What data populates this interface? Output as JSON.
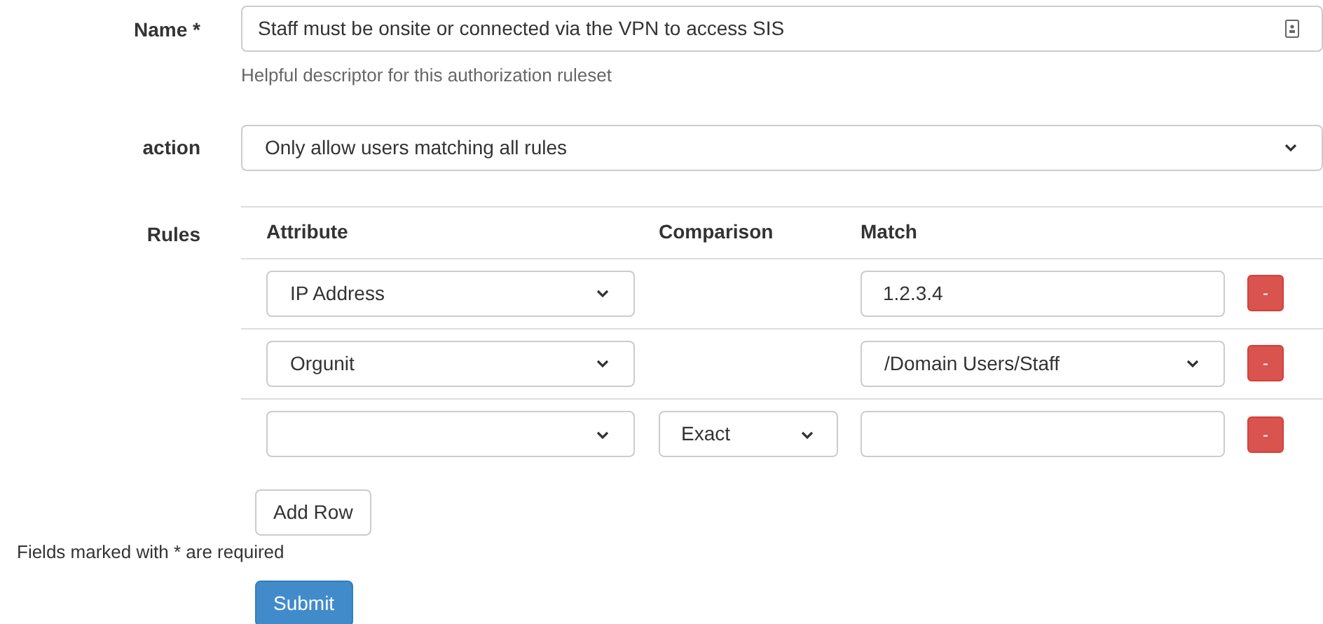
{
  "name_field": {
    "label": "Name *",
    "value": "Staff must be onsite or connected via the VPN to access SIS",
    "help": "Helpful descriptor for this authorization ruleset"
  },
  "action_field": {
    "label": "action",
    "value": "Only allow users matching all rules"
  },
  "rules": {
    "label": "Rules",
    "columns": [
      "Attribute",
      "Comparison",
      "Match"
    ],
    "rows": [
      {
        "attribute": "IP Address",
        "match": {
          "kind": "input",
          "value": "1.2.3.4"
        },
        "delete": "-"
      },
      {
        "attribute": "Orgunit",
        "match": {
          "kind": "select",
          "value": "/Domain Users/Staff"
        },
        "delete": "-"
      },
      {
        "comparison": "Exact",
        "match": {
          "kind": "input"
        },
        "delete": "-"
      }
    ]
  },
  "add_row": "Add Row",
  "required_note": "Fields marked with * are required",
  "submit": "Submit"
}
